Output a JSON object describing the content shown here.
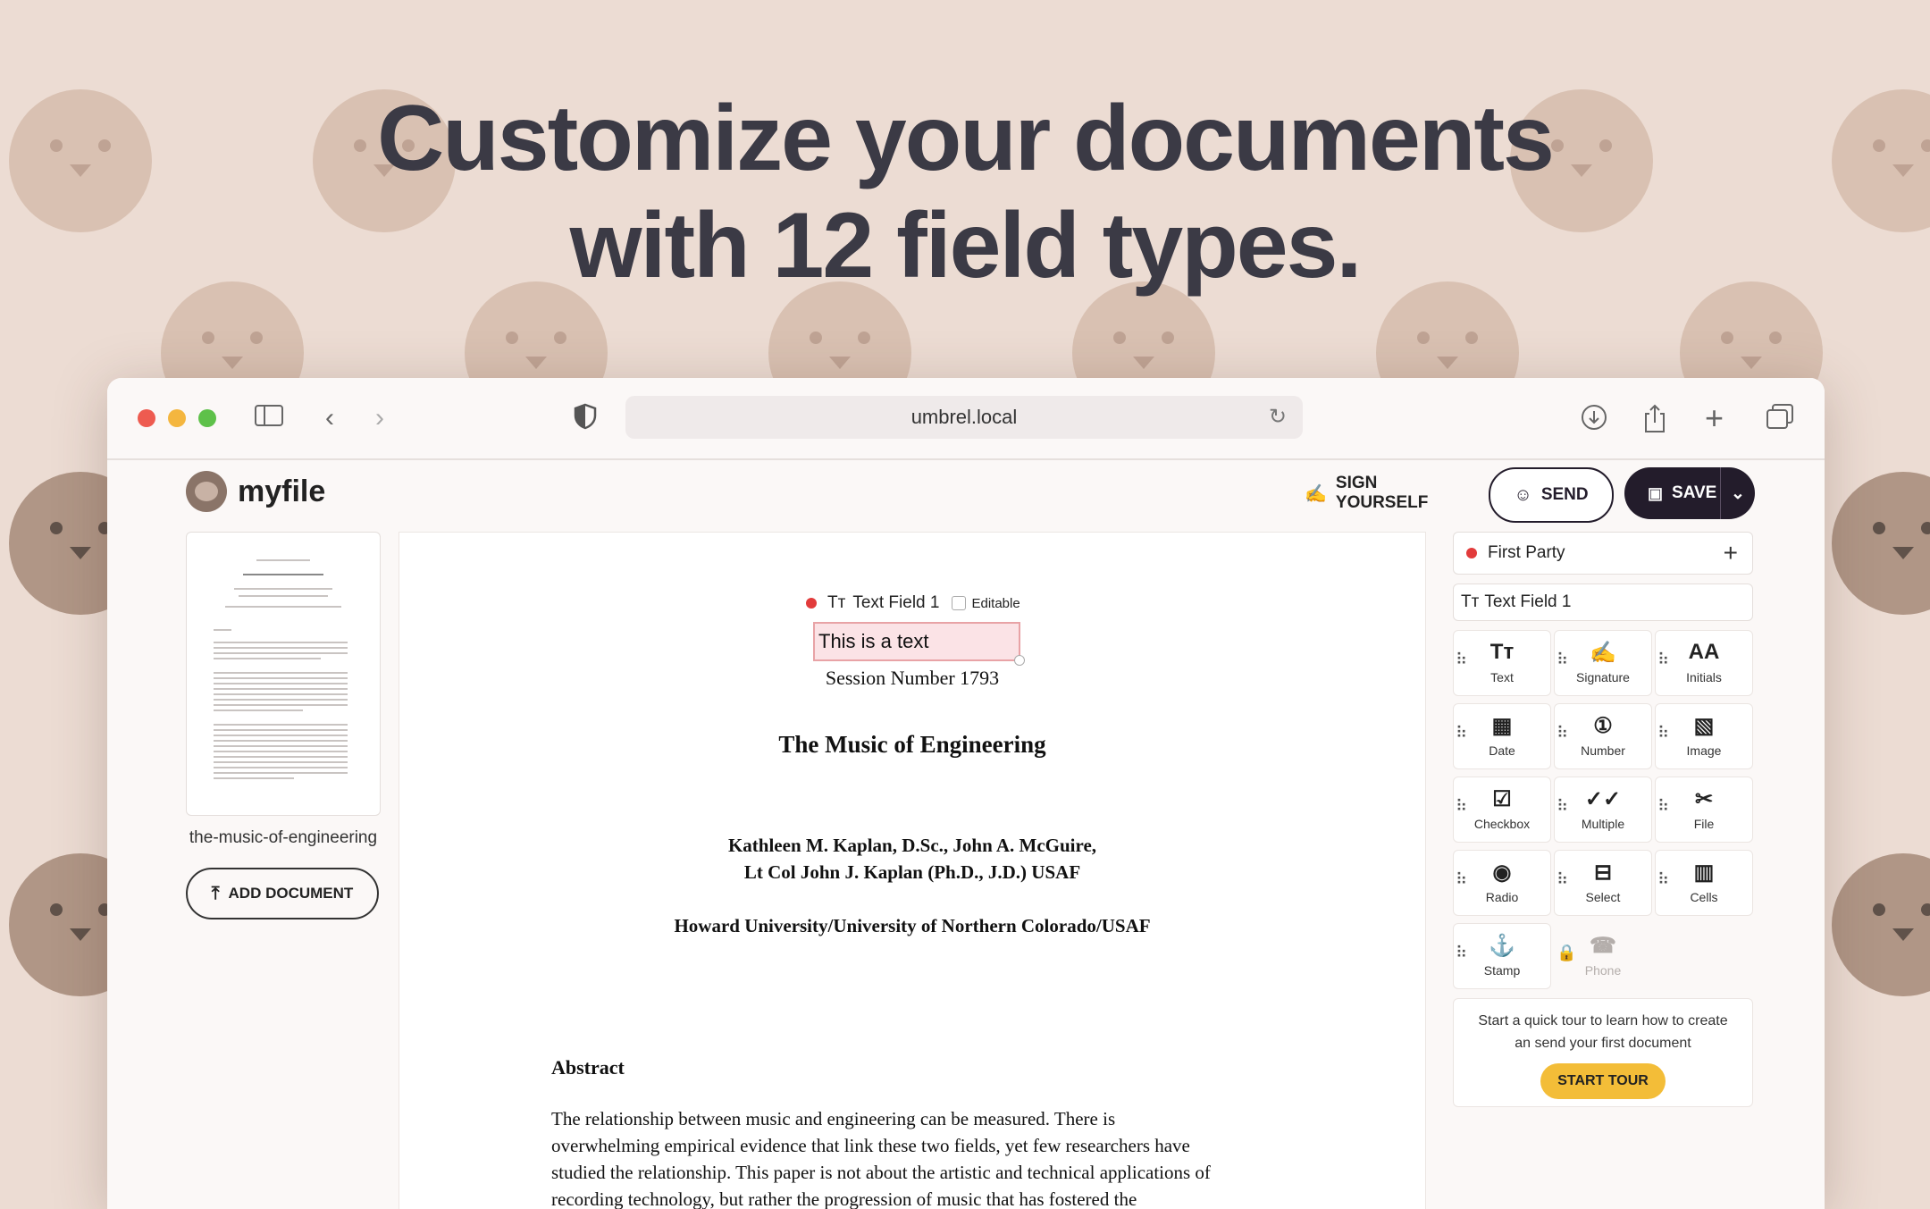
{
  "hero": {
    "line1": "Customize your documents",
    "line2": "with 12 field types."
  },
  "browser": {
    "url": "umbrel.local",
    "icons": [
      "sidebar-icon",
      "back-icon",
      "forward-icon",
      "shield-icon",
      "reload-icon",
      "download-icon",
      "share-icon",
      "new-tab-icon",
      "tabs-icon"
    ]
  },
  "app": {
    "name": "myfile",
    "sign_yourself": "SIGN YOURSELF",
    "send": "SEND",
    "save": "SAVE"
  },
  "sidebar_left": {
    "document_name": "the-music-of-engineering",
    "add_document": "ADD DOCUMENT"
  },
  "document": {
    "field_tag": {
      "name": "Text Field 1",
      "editable": "Editable",
      "value": "This is a text"
    },
    "session": "Session Number 1793",
    "title": "The Music of Engineering",
    "authors_1": "Kathleen M. Kaplan, D.Sc., John A. McGuire,",
    "authors_2": "Lt Col John J. Kaplan (Ph.D., J.D.) USAF",
    "affiliation": "Howard University/University of Northern Colorado/USAF",
    "abstract_heading": "Abstract",
    "abstract_lines": [
      "The relationship between music and engineering can be measured.  There is",
      "overwhelming empirical evidence that link these two fields, yet few researchers have",
      "studied the relationship.  This paper is not about the artistic and technical applications of",
      "recording technology, but rather the progression of music that has fostered the"
    ]
  },
  "sidebar_right": {
    "party": "First Party",
    "current_field": "Text Field 1",
    "fields": [
      {
        "label": "Text",
        "icon": "text-icon",
        "glyph": "Tᴛ",
        "enabled": true
      },
      {
        "label": "Signature",
        "icon": "signature-icon",
        "glyph": "✍",
        "enabled": true
      },
      {
        "label": "Initials",
        "icon": "initials-icon",
        "glyph": "AA",
        "enabled": true
      },
      {
        "label": "Date",
        "icon": "calendar-icon",
        "glyph": "▦",
        "enabled": true
      },
      {
        "label": "Number",
        "icon": "number-icon",
        "glyph": "①",
        "enabled": true
      },
      {
        "label": "Image",
        "icon": "image-icon",
        "glyph": "▧",
        "enabled": true
      },
      {
        "label": "Checkbox",
        "icon": "checkbox-icon",
        "glyph": "☑",
        "enabled": true
      },
      {
        "label": "Multiple",
        "icon": "multiple-check-icon",
        "glyph": "✓✓",
        "enabled": true
      },
      {
        "label": "File",
        "icon": "paperclip-icon",
        "glyph": "✂",
        "enabled": true
      },
      {
        "label": "Radio",
        "icon": "radio-icon",
        "glyph": "◉",
        "enabled": true
      },
      {
        "label": "Select",
        "icon": "select-icon",
        "glyph": "⊟",
        "enabled": true
      },
      {
        "label": "Cells",
        "icon": "cells-icon",
        "glyph": "▥",
        "enabled": true
      },
      {
        "label": "Stamp",
        "icon": "stamp-icon",
        "glyph": "⚓",
        "enabled": true
      },
      {
        "label": "Phone",
        "icon": "phone-icon",
        "glyph": "☎",
        "enabled": false
      }
    ],
    "tour_text_1": "Start a quick tour to learn how to create",
    "tour_text_2": "an send your first document",
    "tour_button": "START TOUR"
  },
  "colors": {
    "background": "#ecdcd3",
    "accent_dark": "#231c2b",
    "party_dot": "#e23b3b",
    "tour_button": "#f3bd38",
    "traffic_red": "#ee5b50",
    "traffic_yellow": "#f4b63f",
    "traffic_green": "#5ec14a"
  }
}
